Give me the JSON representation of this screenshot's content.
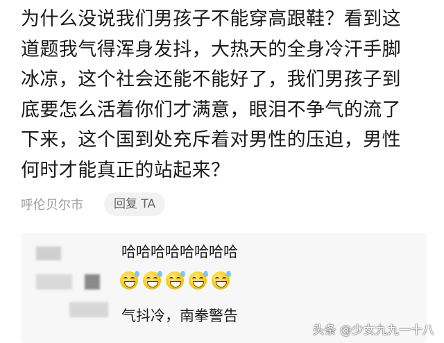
{
  "comment": {
    "lines": [
      "为什么没说我们男孩子不能穿高跟鞋？看到这",
      "道题我气得浑身发抖，大热天的全身冷汗手脚",
      "冰凉，这个社会还能不能好了，我们男孩子到",
      "底要怎么活着你们才满意，眼泪不争气的流了",
      "下来，这个国到处充斥着对男性的压迫，男性",
      "何时才能真正的站起来？"
    ],
    "location": "呼伦贝尔市",
    "reply_label": "回复 TA"
  },
  "replies": [
    {
      "text": "哈哈哈哈哈哈哈哈"
    },
    {
      "emoji": "grinning-sweat-emoji",
      "emoji_count": 5
    },
    {
      "text": "气抖冷，南拳警告"
    }
  ],
  "watermark": "头条 @少女九九一十八"
}
